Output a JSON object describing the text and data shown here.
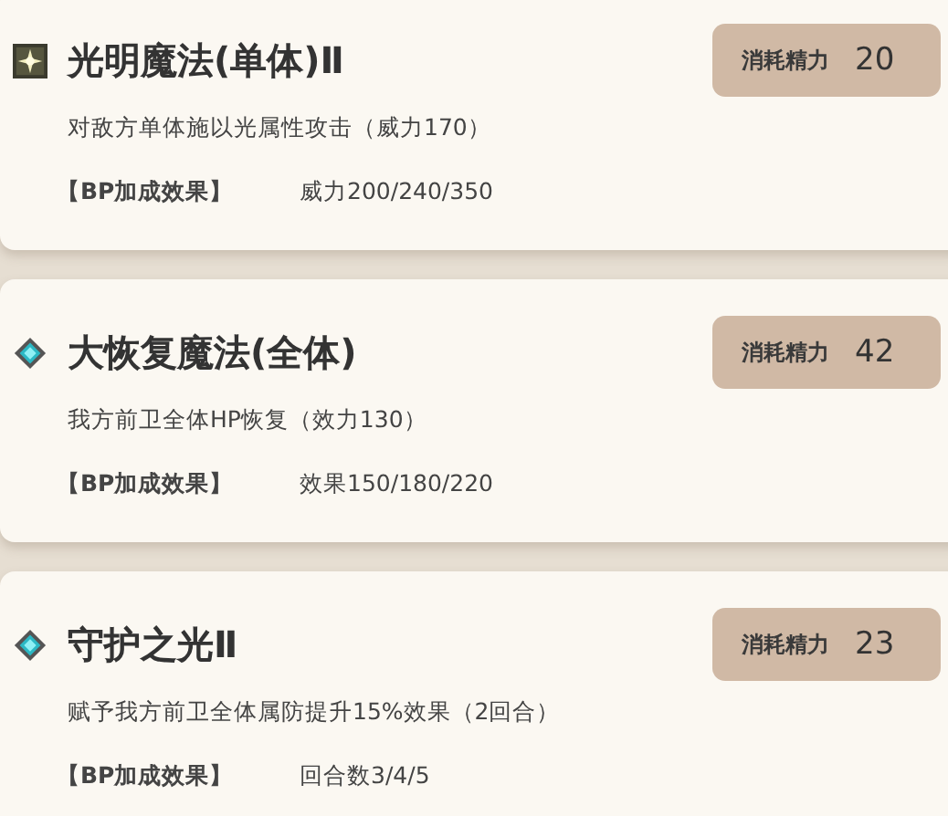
{
  "skills": [
    {
      "kind": "attack",
      "name": "光明魔法(单体)Ⅱ",
      "cost_label": "消耗精力",
      "cost": "20",
      "description": "对敌方单体施以光属性攻击（威力170）",
      "bp_label": "【BP加成效果】",
      "bp_value": "威力200/240/350"
    },
    {
      "kind": "support",
      "name": "大恢复魔法(全体)",
      "cost_label": "消耗精力",
      "cost": "42",
      "description": "我方前卫全体HP恢复（效力130）",
      "bp_label": "【BP加成效果】",
      "bp_value": "效果150/180/220"
    },
    {
      "kind": "support",
      "name": "守护之光Ⅱ",
      "cost_label": "消耗精力",
      "cost": "23",
      "description": "赋予我方前卫全体属防提升15%效果（2回合）",
      "bp_label": "【BP加成效果】",
      "bp_value": "回合数3/4/5"
    }
  ]
}
